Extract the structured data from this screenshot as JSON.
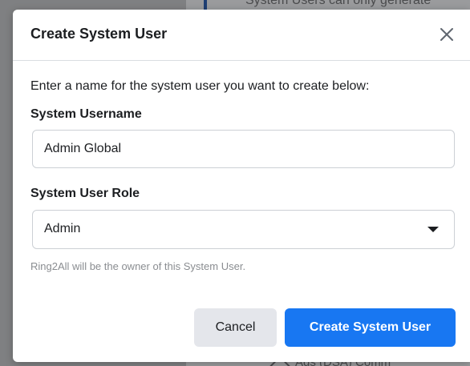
{
  "background": {
    "top_text": "System Users can only generate",
    "bottom_text": "Ads (DSA) Comm"
  },
  "dialog": {
    "title": "Create System User",
    "close_icon": "close-icon",
    "intro": "Enter a name for the system user you want to create below:",
    "username_label": "System Username",
    "username_value": "Admin Global",
    "role_label": "System User Role",
    "role_value": "Admin",
    "owner_note": "Ring2All will be the owner of this System User.",
    "cancel_label": "Cancel",
    "create_label": "Create System User"
  },
  "colors": {
    "primary": "#1877f2",
    "secondary_button": "#e4e6eb",
    "overlay": "#7f8082"
  }
}
